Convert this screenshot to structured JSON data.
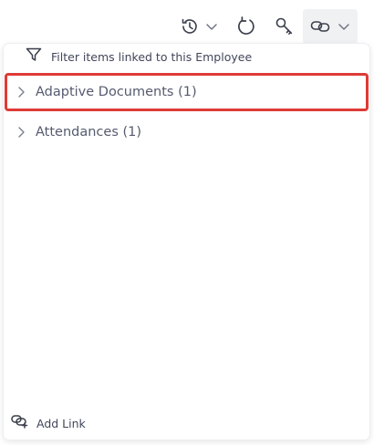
{
  "toolbar": {
    "history_icon": "history-icon",
    "refresh_icon": "refresh-icon",
    "key_icon": "key-icon",
    "link_icon": "link-icon"
  },
  "panel": {
    "filter_label": "Filter items linked to this Employee",
    "groups": [
      {
        "label": "Adaptive Documents (1)",
        "selected": true
      },
      {
        "label": "Attendances (1)",
        "selected": false
      }
    ],
    "add_link_label": "Add Link"
  },
  "colors": {
    "highlight": "#dd3b36",
    "text": "#555b6e",
    "toolbar_active_bg": "#f0f1f3"
  }
}
